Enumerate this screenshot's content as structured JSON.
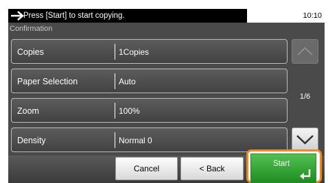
{
  "status": {
    "message": "Press [Start] to start copying.",
    "time": "10:10"
  },
  "panel": {
    "title": "Confirmation"
  },
  "rows": [
    {
      "label": "Copies",
      "value": "1Copies"
    },
    {
      "label": "Paper Selection",
      "value": "Auto"
    },
    {
      "label": "Zoom",
      "value": "100%"
    },
    {
      "label": "Density",
      "value": "Normal 0"
    }
  ],
  "scroll": {
    "page": "1/6",
    "up_icon": "chevron-up-icon",
    "down_icon": "chevron-down-icon"
  },
  "buttons": {
    "cancel": "Cancel",
    "back": "< Back",
    "start": "Start"
  },
  "colors": {
    "accent": "#f08a1e",
    "start_green": "#2fa52f",
    "status_bar": "#000000",
    "panel": "#4a4a4a"
  }
}
